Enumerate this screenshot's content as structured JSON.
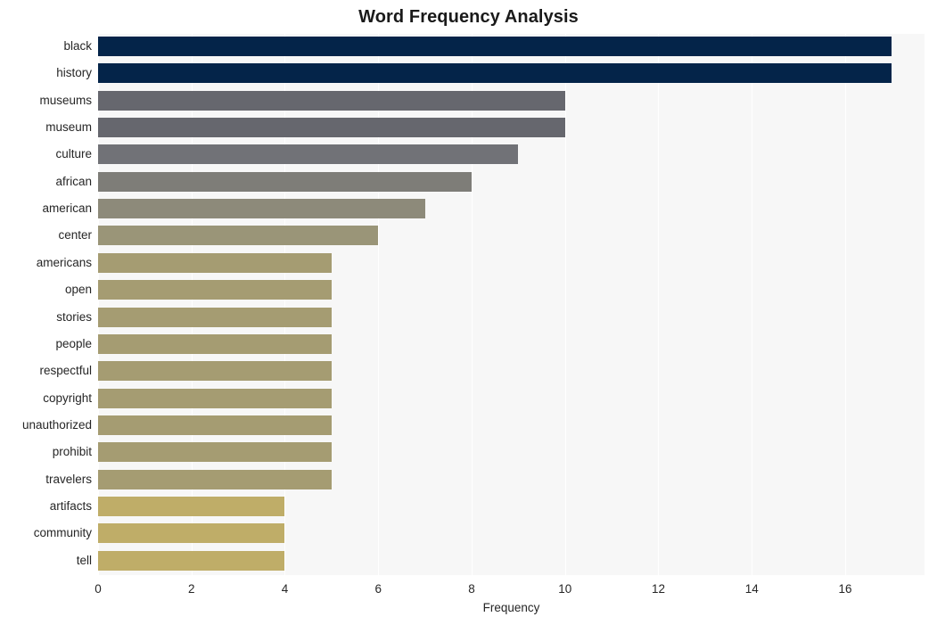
{
  "chart_data": {
    "type": "bar",
    "orientation": "horizontal",
    "title": "Word Frequency Analysis",
    "xlabel": "Frequency",
    "ylabel": "",
    "xlim": [
      0,
      17.7
    ],
    "xticks": [
      0,
      2,
      4,
      6,
      8,
      10,
      12,
      14,
      16
    ],
    "grid": "vertical",
    "legend": "none",
    "categories": [
      "black",
      "history",
      "museums",
      "museum",
      "culture",
      "african",
      "american",
      "center",
      "americans",
      "open",
      "stories",
      "people",
      "respectful",
      "copyright",
      "unauthorized",
      "prohibit",
      "travelers",
      "artifacts",
      "community",
      "tell"
    ],
    "values": [
      17,
      17,
      10,
      10,
      9,
      8,
      7,
      6,
      5,
      5,
      5,
      5,
      5,
      5,
      5,
      5,
      5,
      4,
      4,
      4
    ],
    "bar_colors": [
      "#042449",
      "#042449",
      "#66676e",
      "#66676e",
      "#717277",
      "#7e7d78",
      "#8d8a7a",
      "#9a9578",
      "#a59c72",
      "#a59c72",
      "#a59c72",
      "#a59c72",
      "#a59c72",
      "#a59c72",
      "#a59c72",
      "#a59c72",
      "#a59c72",
      "#bfad68",
      "#bfad68",
      "#bfad68"
    ],
    "plot_background": "#f7f7f7",
    "gridline_color": "#ffffff",
    "figure_background": "#ffffff"
  }
}
